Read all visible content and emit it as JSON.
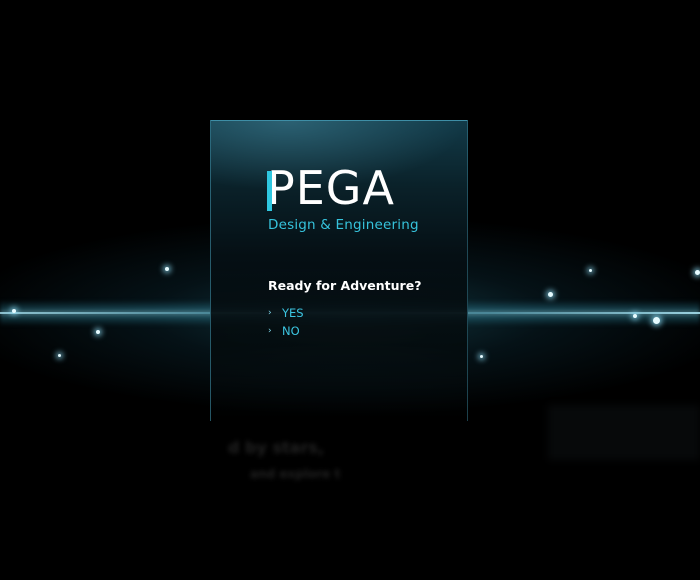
{
  "brand": {
    "logo_text": "PEGA",
    "tagline": "Design & Engineering",
    "accent_color": "#2fc7e0"
  },
  "prompt": {
    "question": "Ready for Adventure?",
    "options": [
      {
        "label": "YES",
        "icon": "chevron-right-icon"
      },
      {
        "label": "NO",
        "icon": "chevron-right-icon"
      }
    ]
  },
  "background_text": {
    "line1": "d by stars,",
    "line2": "and explore t"
  },
  "colors": {
    "background": "#000000",
    "option_text": "#3cc6e2",
    "beam": "#aaebfa"
  }
}
